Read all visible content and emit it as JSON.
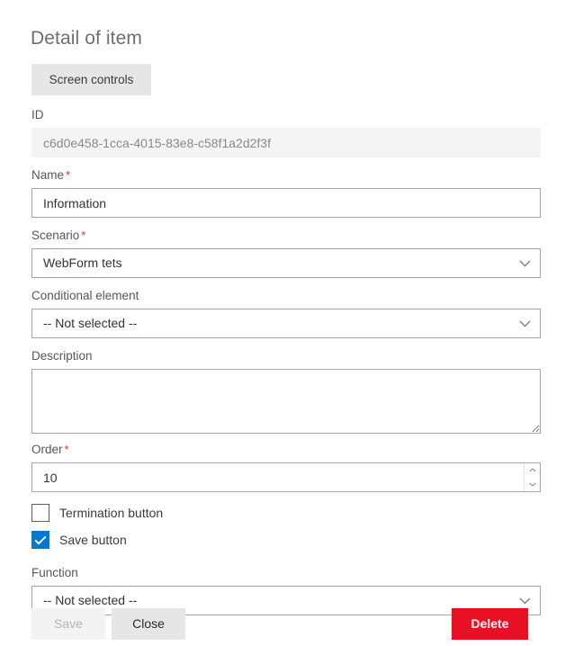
{
  "page": {
    "title": "Detail of item"
  },
  "toolbar": {
    "screen_controls_label": "Screen controls"
  },
  "form": {
    "id": {
      "label": "ID",
      "value": "c6d0e458-1cca-4015-83e8-c58f1a2d2f3f"
    },
    "name": {
      "label": "Name",
      "required_mark": "*",
      "value": "Information"
    },
    "scenario": {
      "label": "Scenario",
      "required_mark": "*",
      "value": "WebForm tets"
    },
    "conditional_element": {
      "label": "Conditional element",
      "value": "-- Not selected --"
    },
    "description": {
      "label": "Description",
      "value": ""
    },
    "order": {
      "label": "Order",
      "required_mark": "*",
      "value": "10"
    },
    "termination_button": {
      "label": "Termination button",
      "checked": false
    },
    "save_button_option": {
      "label": "Save button",
      "checked": true
    },
    "function": {
      "label": "Function",
      "value": "-- Not selected --"
    }
  },
  "footer": {
    "save_label": "Save",
    "close_label": "Close",
    "delete_label": "Delete"
  },
  "colors": {
    "accent": "#0078d4",
    "danger": "#e81123",
    "required": "#d93025",
    "button_grey": "#e6e6e6",
    "readonly_bg": "#f4f4f4"
  }
}
